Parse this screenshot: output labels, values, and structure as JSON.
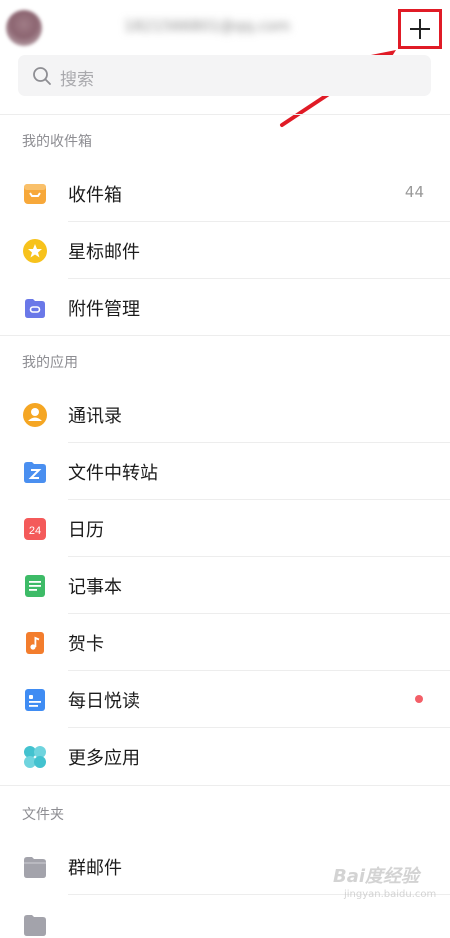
{
  "header": {
    "account_email": "1821566801@qq.com",
    "add_label": "+"
  },
  "search": {
    "placeholder": "搜索"
  },
  "sections": {
    "inbox_section": "我的收件箱",
    "apps_section": "我的应用",
    "folders_section": "文件夹"
  },
  "inbox_items": [
    {
      "label": "收件箱",
      "icon": "inbox-tray-icon",
      "count": "44"
    },
    {
      "label": "星标邮件",
      "icon": "star-icon"
    },
    {
      "label": "附件管理",
      "icon": "attachment-icon"
    }
  ],
  "app_items": [
    {
      "label": "通讯录",
      "icon": "contacts-icon"
    },
    {
      "label": "文件中转站",
      "icon": "file-transfer-icon"
    },
    {
      "label": "日历",
      "icon": "calendar-icon",
      "icon_text": "24"
    },
    {
      "label": "记事本",
      "icon": "notepad-icon"
    },
    {
      "label": "贺卡",
      "icon": "greeting-card-icon"
    },
    {
      "label": "每日悦读",
      "icon": "daily-reading-icon",
      "has_unread_dot": true
    },
    {
      "label": "更多应用",
      "icon": "more-apps-icon"
    }
  ],
  "folder_items": [
    {
      "label": "群邮件",
      "icon": "folder-icon"
    }
  ],
  "watermark": {
    "brand": "Bai度经验",
    "url": "jingyan.baidu.com"
  },
  "colors": {
    "highlight_red": "#e01b26",
    "inbox_orange": "#f7a83a",
    "star_yellow": "#f7c21c",
    "attachment_purple": "#6a78e8",
    "contacts_orange": "#f5a623",
    "file_transfer_blue": "#4a8ff0",
    "calendar_red": "#f45a5a",
    "notepad_green": "#3dbb67",
    "card_orange": "#f37d2d",
    "reading_blue": "#3f8cf3",
    "more_teal": "#43c2cf",
    "unread_dot": "#f35f68"
  }
}
